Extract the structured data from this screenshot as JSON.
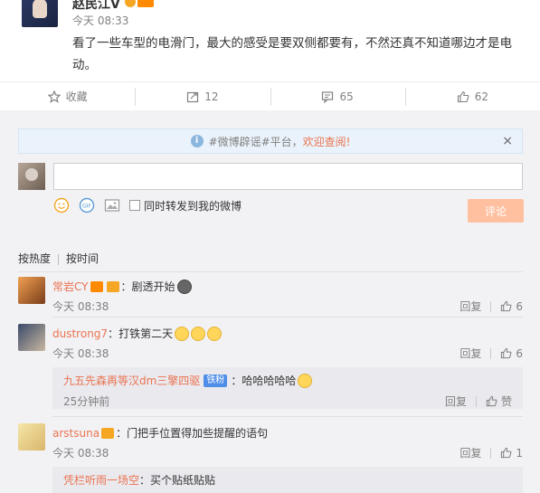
{
  "post": {
    "author": "赵民江V",
    "time": "今天 08:33",
    "text": "看了一些车型的电滑门，最大的感受是要双侧都要有，不然还真不知道哪边才是电动。"
  },
  "actions": {
    "collect": "收藏",
    "repost": "12",
    "comment": "65",
    "like": "62"
  },
  "notice": {
    "prefix": "#微博辟谣#平台，",
    "highlight": "欢迎查阅!",
    "close": "×"
  },
  "composer": {
    "placeholder": "",
    "forward_label": "同时转发到我的微博",
    "submit": "评论"
  },
  "sort": {
    "by_heat": "按热度",
    "by_time": "按时间"
  },
  "comments": [
    {
      "user": "常岩CY",
      "text": "：剧透开始",
      "time": "今天 08:38",
      "reply": "回复",
      "likes": "6"
    },
    {
      "user": "dustrong7",
      "text": "：打铁第二天",
      "time": "今天 08:38",
      "reply": "回复",
      "likes": "6",
      "sub": {
        "user": "九五先森再等汉dm三擎四驱",
        "badge": "铁粉",
        "text": "：哈哈哈哈哈",
        "time": "25分钟前",
        "reply": "回复",
        "like_label": "赞"
      }
    },
    {
      "user": "arstsuna",
      "text": "：门把手位置得加些提醒的语句",
      "time": "今天 08:38",
      "reply": "回复",
      "likes": "1",
      "sub": {
        "user": "凭栏听雨一场空",
        "text": "：买个贴纸贴贴"
      }
    }
  ],
  "colors": {
    "accent": "#eb7350",
    "submit_bg": "#ffc09f",
    "notice_bg": "#eaf3fb",
    "panel_bg": "#f2f2f5"
  }
}
